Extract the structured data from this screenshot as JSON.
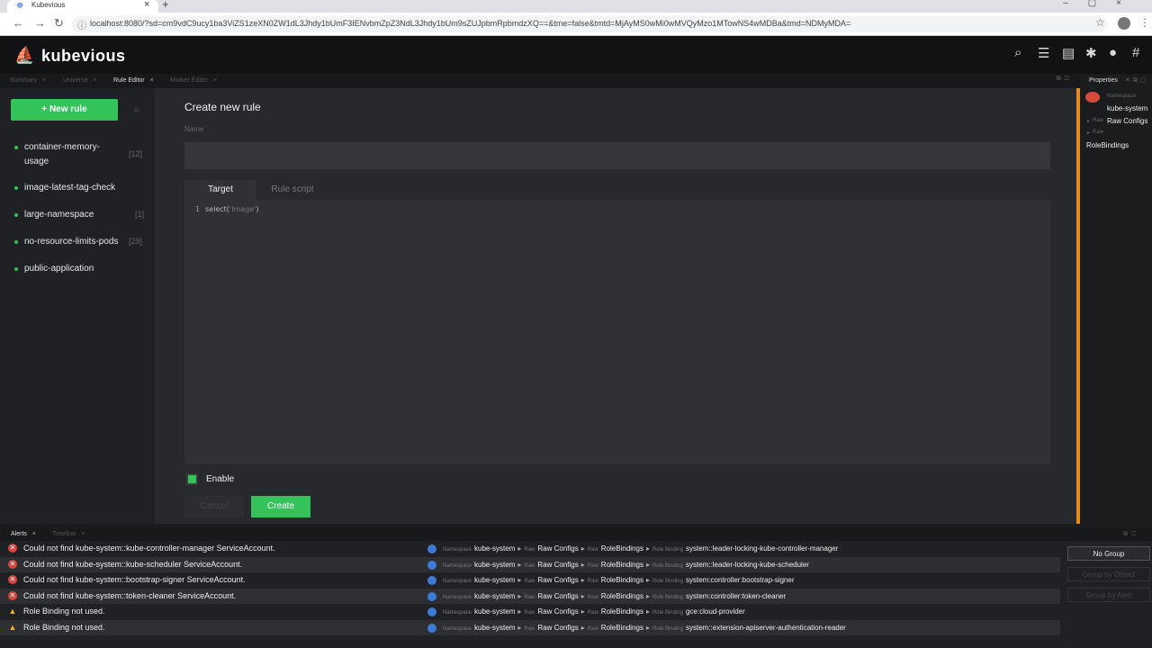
{
  "browser": {
    "tab_title": "Kubevious",
    "url": "localhost:8080/?sd=cm9vdC9ucy1ba3ViZS1zeXN0ZW1dL3Jhdy1bUmF3IENvbmZpZ3NdL3Jhdy1bUm9sZUJpbmRpbmdzXQ==&tme=false&tmtd=MjAyMS0wMi0wMVQyMzo1MTowNS4wMDBa&tmd=NDMyMDA="
  },
  "app": {
    "brand": "kubevious",
    "header_icons": [
      "search-icon",
      "sliders-icon",
      "server-icon",
      "bug-icon",
      "github-icon",
      "slack-icon"
    ]
  },
  "panel_tabs": {
    "summary": "Summary",
    "universe": "Universe",
    "rule_editor": "Rule Editor",
    "marker_editor": "Marker Editor"
  },
  "sidebar": {
    "new_rule": "+ New rule",
    "rules": [
      {
        "name": "container-memory-usage",
        "count": "[12]"
      },
      {
        "name": "image-latest-tag-check",
        "count": ""
      },
      {
        "name": "large-namespace",
        "count": "[1]"
      },
      {
        "name": "no-resource-limits-pods",
        "count": "[29]"
      },
      {
        "name": "public-application",
        "count": ""
      }
    ]
  },
  "editor": {
    "title": "Create new rule",
    "name_label": "Name",
    "tab_target": "Target",
    "tab_script": "Rule script",
    "code_line_number": "1",
    "code_fn": "select(",
    "code_str": "'Image'",
    "code_close": ")",
    "enable_label": "Enable",
    "cancel": "Cancel",
    "create": "Create",
    "enabled": true
  },
  "properties": {
    "tab": "Properties",
    "ns_kind": "Namespace",
    "ns_value": "kube-system",
    "raw_kind_1": "Raw",
    "raw_value_1": "Raw Configs",
    "raw_kind_2": "Raw",
    "raw_value_2": "RoleBindings"
  },
  "alerts": {
    "tab_alerts": "Alerts",
    "tab_timeline": "Timeline",
    "rows": [
      {
        "severity": "error",
        "message": "Could not find kube-system::kube-controller-manager ServiceAccount.",
        "binding": "system::leader-locking-kube-controller-manager"
      },
      {
        "severity": "error",
        "message": "Could not find kube-system::kube-scheduler ServiceAccount.",
        "binding": "system::leader-locking-kube-scheduler"
      },
      {
        "severity": "error",
        "message": "Could not find kube-system::bootstrap-signer ServiceAccount.",
        "binding": "system:controller:bootstrap-signer"
      },
      {
        "severity": "error",
        "message": "Could not find kube-system::token-cleaner ServiceAccount.",
        "binding": "system:controller:token-cleaner"
      },
      {
        "severity": "warning",
        "message": "Role Binding not used.",
        "binding": "gce:cloud-provider"
      },
      {
        "severity": "warning",
        "message": "Role Binding not used.",
        "binding": "system::extension-apiserver-authentication-reader"
      }
    ],
    "path": {
      "ns_kind": "Namespace",
      "ns": "kube-system",
      "raw_kind": "Raw",
      "raw": "Raw Configs",
      "rb_kind": "Raw",
      "rb": "RoleBindings",
      "binding_kind": "Role Binding"
    },
    "group_buttons": {
      "no_group": "No Group",
      "by_object": "Group by Object",
      "by_alert": "Group by Alert"
    }
  },
  "colors": {
    "accent": "#34c25b",
    "error": "#d9443a",
    "warning": "#f0b429",
    "highlight": "#e38b1e"
  }
}
